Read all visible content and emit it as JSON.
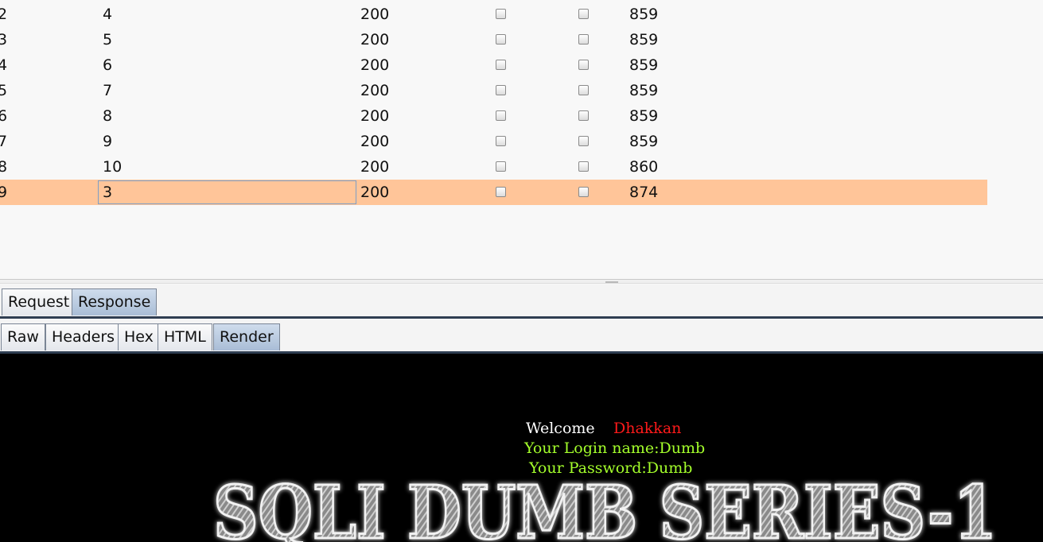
{
  "results": {
    "rows": [
      {
        "request": "2",
        "payload": "4",
        "status": "200",
        "length": "859"
      },
      {
        "request": "3",
        "payload": "5",
        "status": "200",
        "length": "859"
      },
      {
        "request": "4",
        "payload": "6",
        "status": "200",
        "length": "859"
      },
      {
        "request": "5",
        "payload": "7",
        "status": "200",
        "length": "859"
      },
      {
        "request": "6",
        "payload": "8",
        "status": "200",
        "length": "859"
      },
      {
        "request": "7",
        "payload": "9",
        "status": "200",
        "length": "859"
      },
      {
        "request": "8",
        "payload": "10",
        "status": "200",
        "length": "860"
      },
      {
        "request": "9",
        "payload": "3",
        "status": "200",
        "length": "874",
        "selected": true
      }
    ]
  },
  "message_tabs": [
    {
      "label": "Request",
      "active": false
    },
    {
      "label": "Response",
      "active": true
    }
  ],
  "view_tabs": [
    {
      "label": "Raw",
      "active": false
    },
    {
      "label": "Headers",
      "active": false
    },
    {
      "label": "Hex",
      "active": false
    },
    {
      "label": "HTML",
      "active": false
    },
    {
      "label": "Render",
      "active": true
    }
  ],
  "render": {
    "welcome": "Welcome",
    "name": "Dhakkan",
    "login": "Your Login name:Dumb",
    "password": "Your Password:Dumb",
    "banner": "SQLI DUMB SERIES-1"
  },
  "colors": {
    "selected_row": "#ffc599",
    "active_tab": "#a9bdd6",
    "render_bg": "#000000",
    "name_text": "#ff1a1a",
    "credentials_text": "#a4ff2b"
  }
}
